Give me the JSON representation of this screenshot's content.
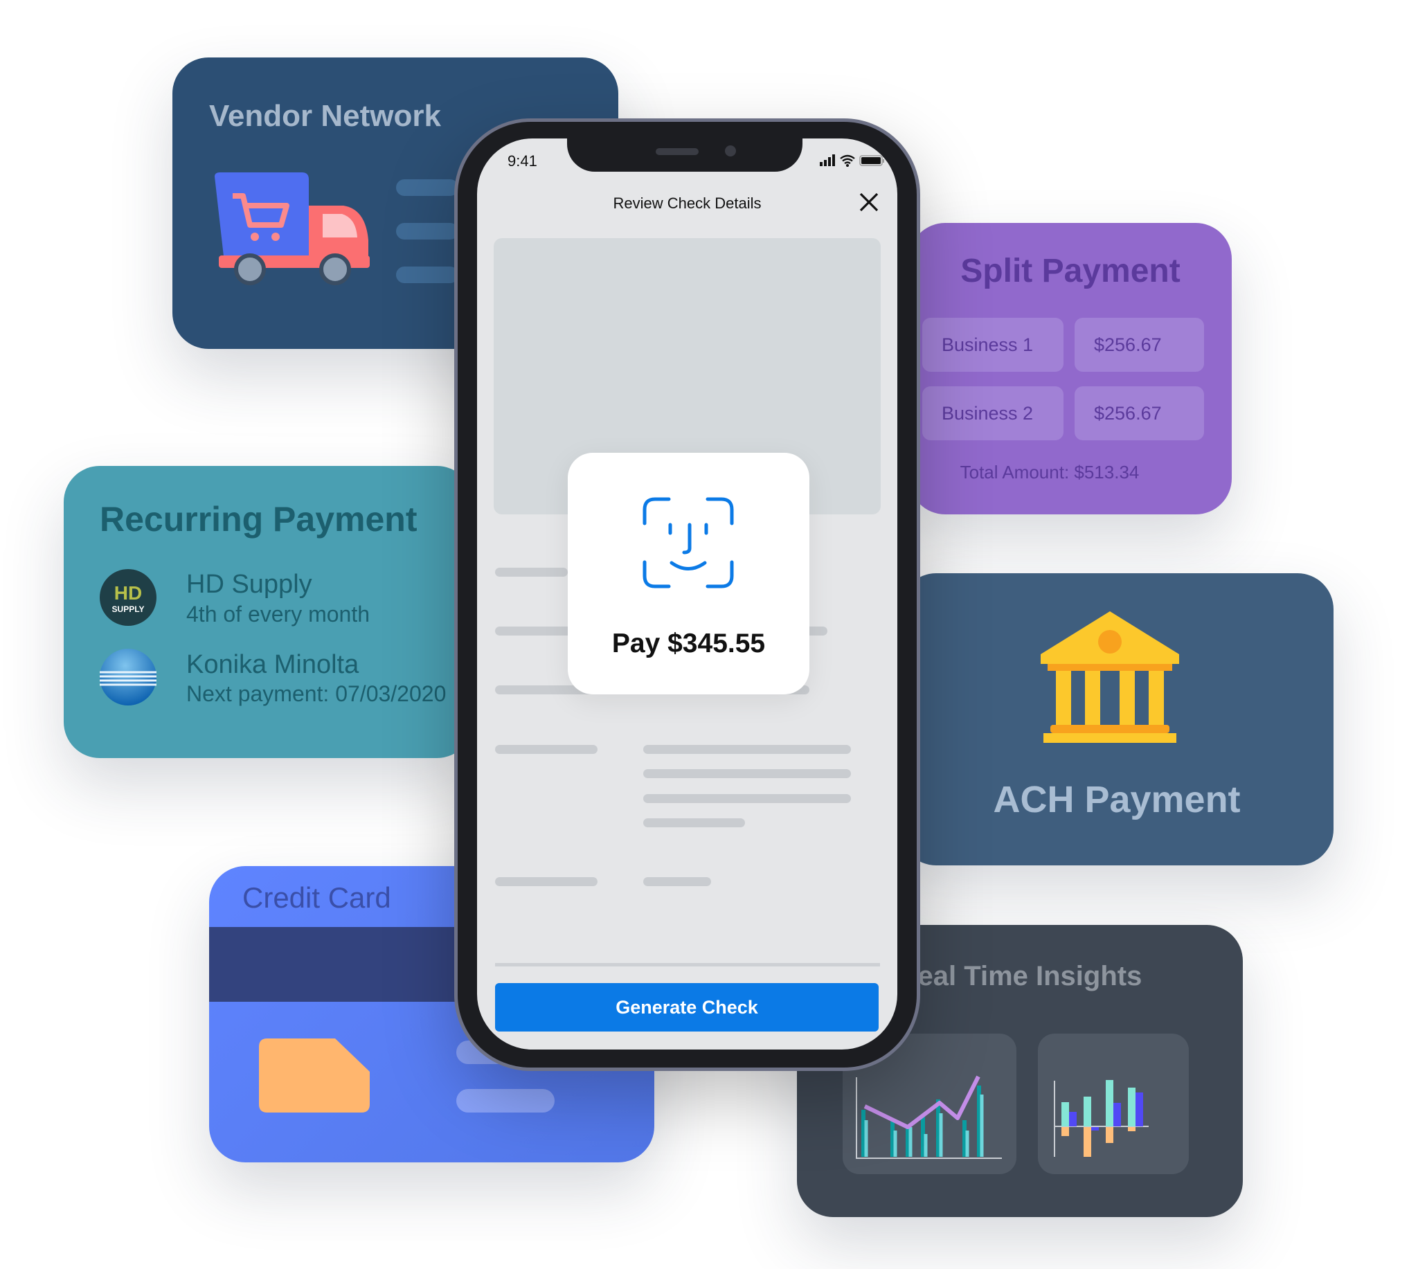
{
  "vendor_network": {
    "title": "Vendor Network",
    "icon": "delivery-truck-cart-icon"
  },
  "split_payment": {
    "title": "Split Payment",
    "rows": [
      {
        "label": "Business  1",
        "amount": "$256.67"
      },
      {
        "label": "Business  2",
        "amount": "$256.67"
      }
    ],
    "total": "Total Amount: $513.34"
  },
  "recurring_payment": {
    "title": "Recurring Payment",
    "items": [
      {
        "name": "HD Supply",
        "detail": "4th of every month",
        "logo": "HD SUPPLY"
      },
      {
        "name": "Konika Minolta",
        "detail": "Next payment: 07/03/2020"
      }
    ]
  },
  "ach_payment": {
    "title": "ACH Payment",
    "icon": "bank-icon"
  },
  "credit_card": {
    "title": "Credit Card"
  },
  "real_time_insights": {
    "title": "Real Time Insights",
    "icons": [
      "line-bar-chart-icon",
      "bar-chart-icon"
    ]
  },
  "phone": {
    "status": {
      "time": "9:41"
    },
    "header": {
      "title": "Review Check Details"
    },
    "face_id": {
      "label": "Pay $345.55"
    },
    "primary_button": "Generate Check",
    "accent": "#0b7ae6"
  }
}
